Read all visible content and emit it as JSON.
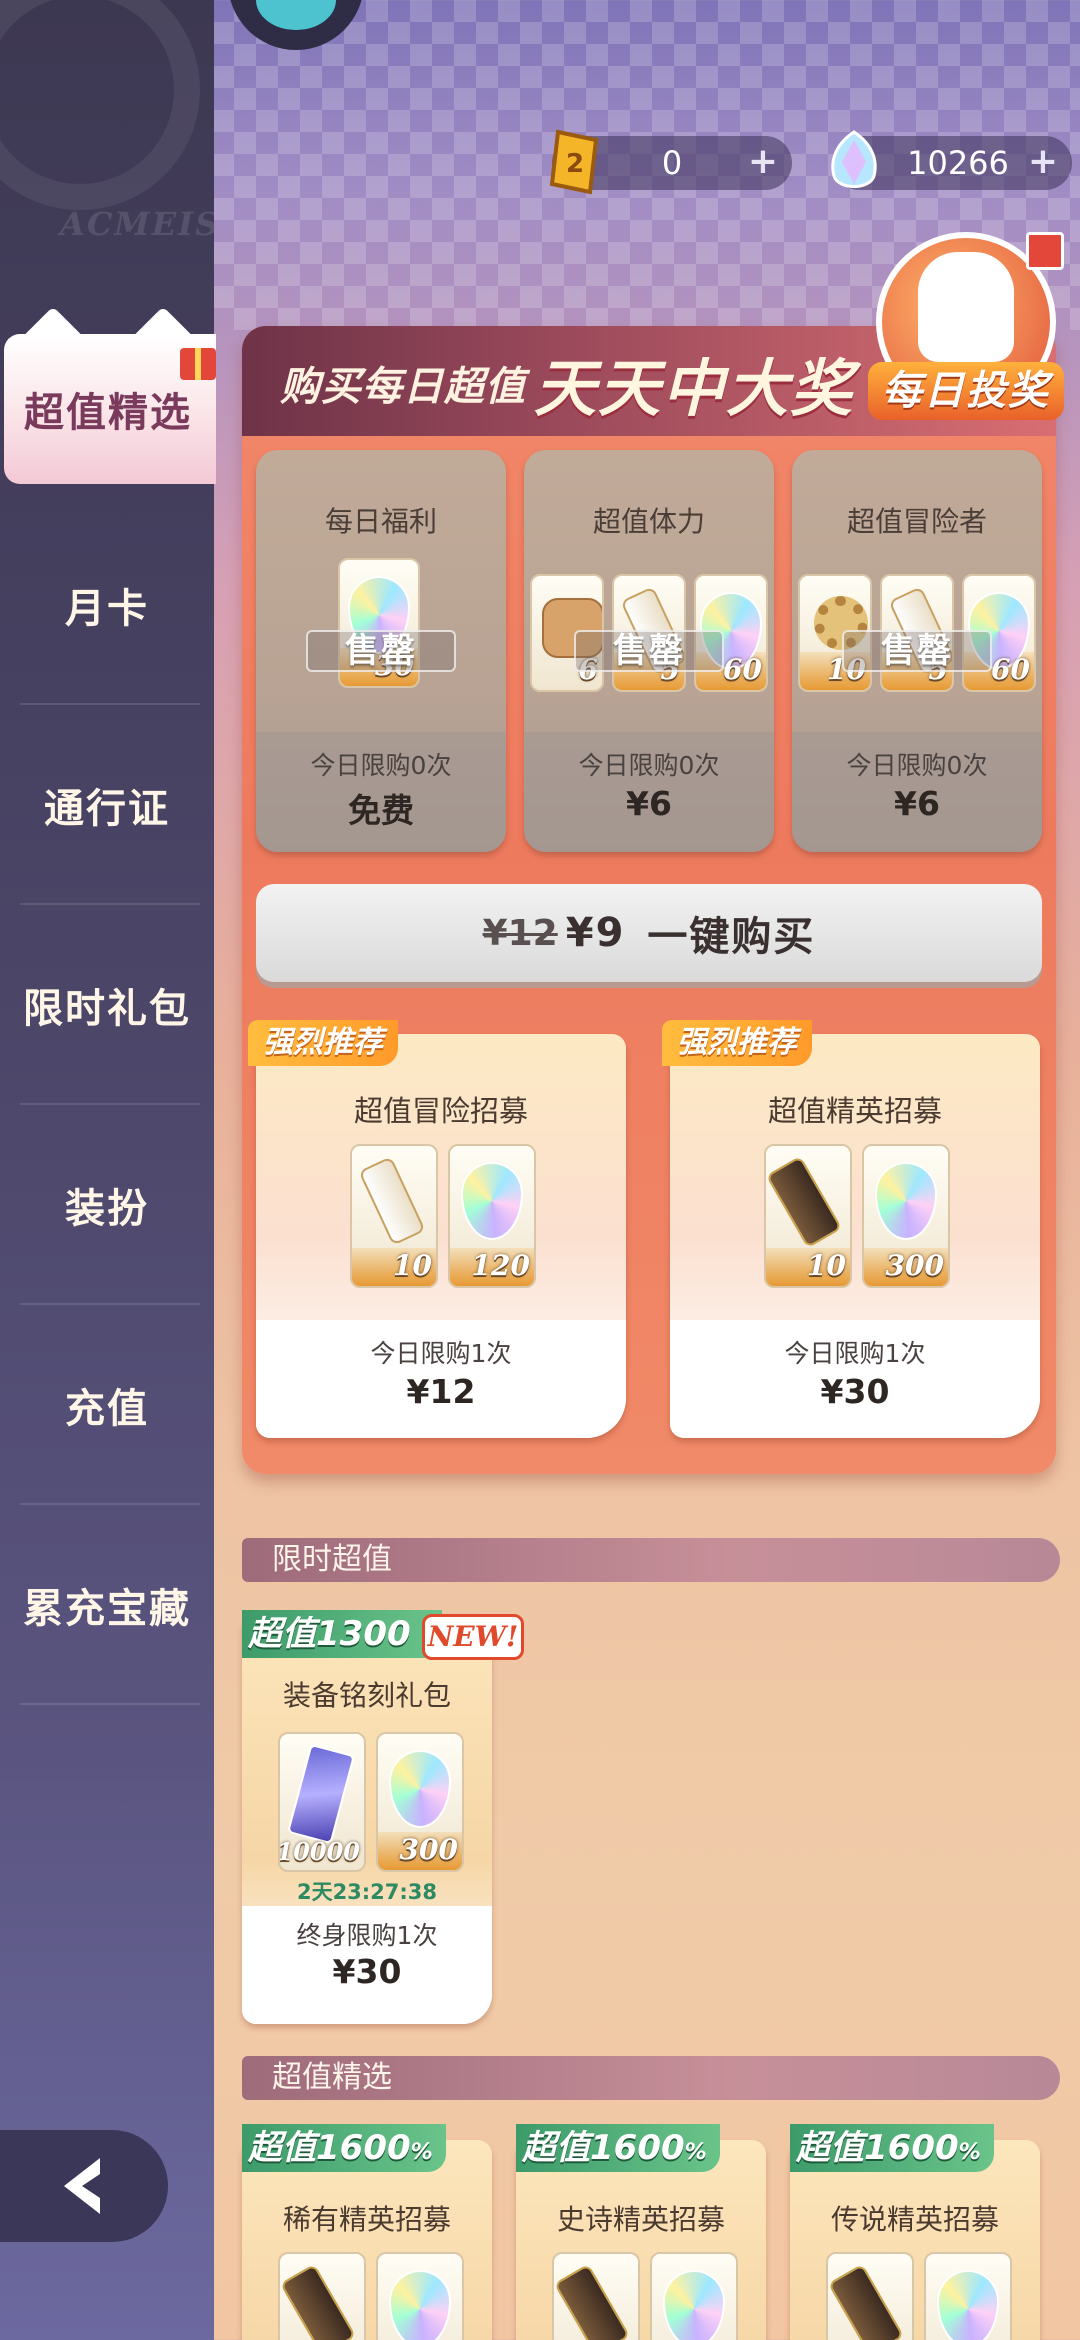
{
  "sidebar": {
    "emblem_text": "ACMEIS",
    "active": "超值精选",
    "items": [
      "月卡",
      "通行证",
      "限时礼包",
      "装扮",
      "充值",
      "累充宝藏"
    ]
  },
  "currency": {
    "gold": "0",
    "gem": "10266"
  },
  "banner": {
    "small_text": "购买每日超值",
    "big_text": "天天中大奖",
    "badge": "每日投奖"
  },
  "daily": [
    {
      "title": "每日福利",
      "sold": "售罄",
      "limit": "今日限购0次",
      "price": "免费",
      "items": [
        {
          "icon": "gem-icon",
          "qty": "30"
        }
      ]
    },
    {
      "title": "超值体力",
      "sold": "售罄",
      "limit": "今日限购0次",
      "price": "¥6",
      "items": [
        {
          "icon": "bread-icon",
          "qty": "6"
        },
        {
          "icon": "scroll-icon",
          "qty": "5"
        },
        {
          "icon": "gem-icon",
          "qty": "60"
        }
      ]
    },
    {
      "title": "超值冒险者",
      "sold": "售罄",
      "limit": "今日限购0次",
      "price": "¥6",
      "items": [
        {
          "icon": "cog-icon",
          "qty": "10"
        },
        {
          "icon": "scroll-icon",
          "qty": "5"
        },
        {
          "icon": "gem-icon",
          "qty": "60"
        }
      ]
    }
  ],
  "buy_all": {
    "old_price": "¥12",
    "new_price": "¥9",
    "label": "一键购买"
  },
  "recommend": [
    {
      "tag": "强烈推荐",
      "title": "超值冒险招募",
      "limit": "今日限购1次",
      "price": "¥12",
      "items": [
        {
          "icon": "scroll-icon",
          "qty": "10"
        },
        {
          "icon": "gem-icon",
          "qty": "120"
        }
      ]
    },
    {
      "tag": "强烈推荐",
      "title": "超值精英招募",
      "limit": "今日限购1次",
      "price": "¥30",
      "items": [
        {
          "icon": "red-scroll-icon",
          "qty": "10"
        },
        {
          "icon": "gem-icon",
          "qty": "300"
        }
      ]
    }
  ],
  "limited": {
    "section_title": "限时超值",
    "card": {
      "tag_prefix": "超值",
      "tag_value": "1300",
      "new_label": "NEW!",
      "title": "装备铭刻礼包",
      "items": [
        {
          "icon": "crystal-icon",
          "qty": "10000"
        },
        {
          "icon": "gem-icon",
          "qty": "300"
        }
      ],
      "timer": "2天23:27:38",
      "limit": "终身限购1次",
      "price": "¥30"
    }
  },
  "featured": {
    "section_title": "超值精选",
    "cards": [
      {
        "tag_prefix": "超值",
        "tag_value": "1600",
        "tag_suffix": "%",
        "title": "稀有精英招募"
      },
      {
        "tag_prefix": "超值",
        "tag_value": "1600",
        "tag_suffix": "%",
        "title": "史诗精英招募"
      },
      {
        "tag_prefix": "超值",
        "tag_value": "1600",
        "tag_suffix": "%",
        "title": "传说精英招募"
      }
    ]
  }
}
